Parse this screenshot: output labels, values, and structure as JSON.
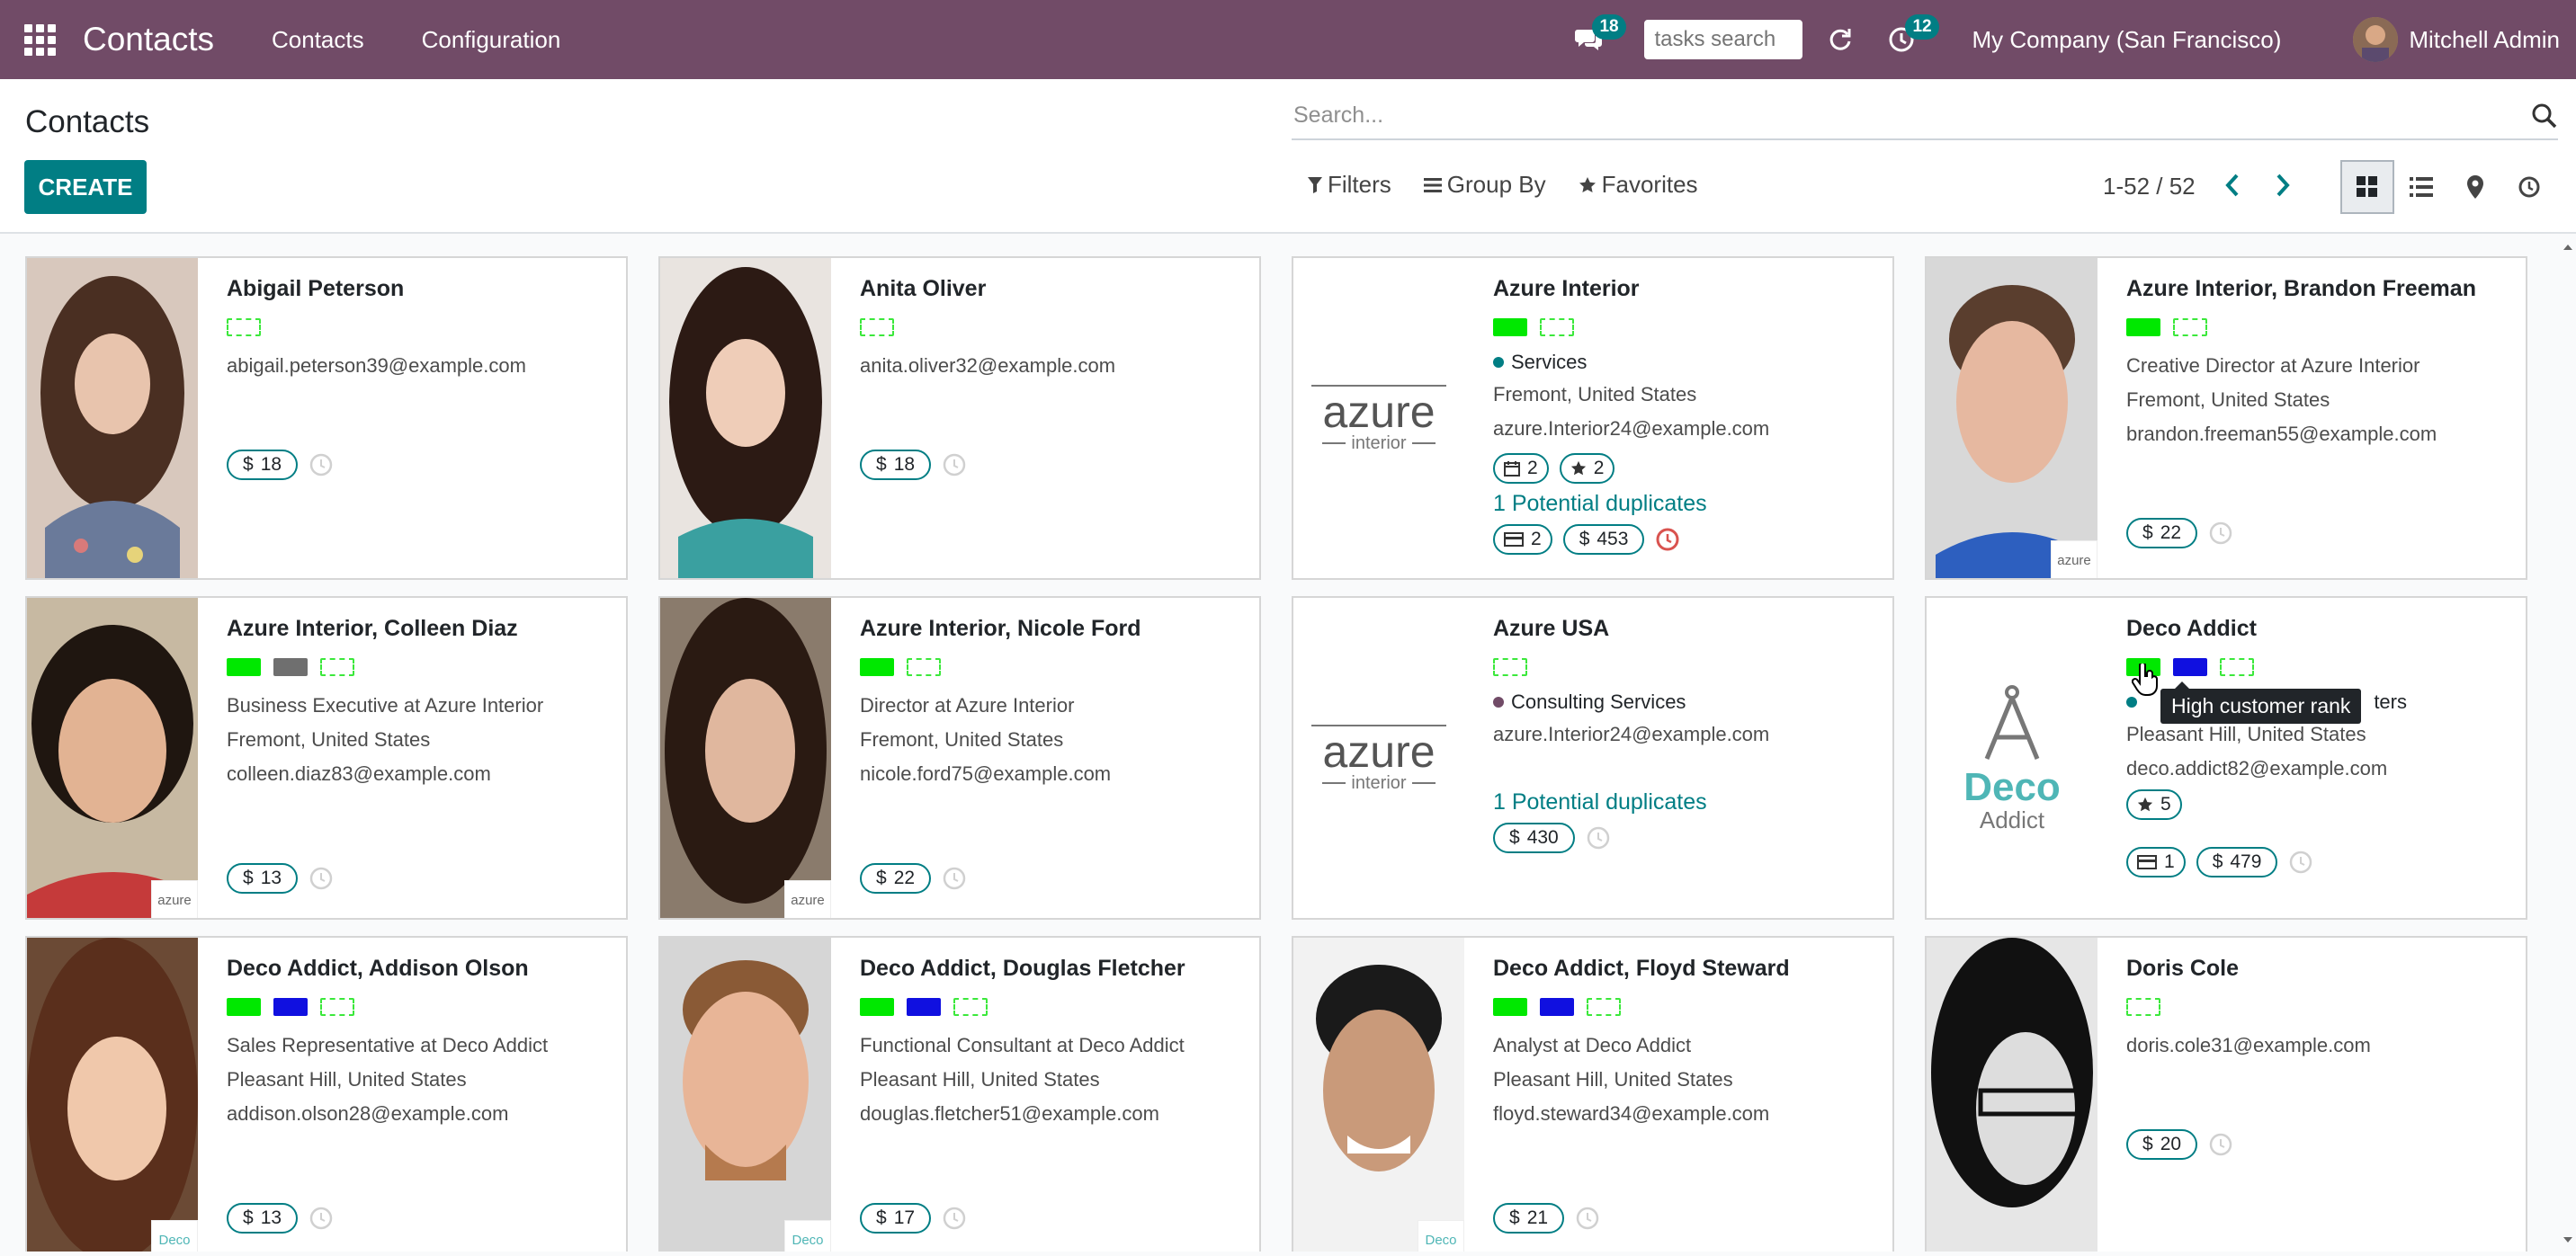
{
  "navbar": {
    "app_name": "Contacts",
    "menus": [
      "Contacts",
      "Configuration"
    ],
    "messages_count": "18",
    "tasks_search_placeholder": "tasks search",
    "activities_count": "12",
    "company": "My Company (San Francisco)",
    "user": "Mitchell Admin"
  },
  "control": {
    "breadcrumb": "Contacts",
    "create_label": "CREATE",
    "search_placeholder": "Search...",
    "filters_label": "Filters",
    "groupby_label": "Group By",
    "favorites_label": "Favorites",
    "pager": "1-52 / 52"
  },
  "tooltip": "High customer rank",
  "cards": [
    {
      "name": "Abigail Peterson",
      "lines": [
        "abigail.peterson39@example.com"
      ],
      "money": "18"
    },
    {
      "name": "Anita Oliver",
      "lines": [
        "anita.oliver32@example.com"
      ],
      "money": "18"
    },
    {
      "name": "Azure Interior",
      "category": "Services",
      "lines": [
        "Fremont, United States",
        "azure.Interior24@example.com"
      ],
      "meetings": "2",
      "stars": "2",
      "duplicates": "1 Potential duplicates",
      "cards_count": "2",
      "money": "453",
      "logo_text": "azure",
      "logo_sub": "interior"
    },
    {
      "name": "Azure Interior, Brandon Freeman",
      "lines": [
        "Creative Director at Azure Interior",
        "Fremont, United States",
        "brandon.freeman55@example.com"
      ],
      "money": "22",
      "mini_logo": "azure"
    },
    {
      "name": "Azure Interior, Colleen Diaz",
      "lines": [
        "Business Executive at Azure Interior",
        "Fremont, United States",
        "colleen.diaz83@example.com"
      ],
      "money": "13",
      "mini_logo": "azure"
    },
    {
      "name": "Azure Interior, Nicole Ford",
      "lines": [
        "Director at Azure Interior",
        "Fremont, United States",
        "nicole.ford75@example.com"
      ],
      "money": "22",
      "mini_logo": "azure"
    },
    {
      "name": "Azure USA",
      "category": "Consulting Services",
      "lines": [
        "azure.Interior24@example.com"
      ],
      "duplicates": "1 Potential duplicates",
      "money": "430",
      "logo_text": "azure",
      "logo_sub": "interior"
    },
    {
      "name": "Deco Addict",
      "category": "ters",
      "lines": [
        "Pleasant Hill, United States",
        "deco.addict82@example.com"
      ],
      "stars": "5",
      "cards_count": "1",
      "money": "479",
      "logo_text": "Deco",
      "logo_sub": "Addict"
    },
    {
      "name": "Deco Addict, Addison Olson",
      "lines": [
        "Sales Representative at Deco Addict",
        "Pleasant Hill, United States",
        "addison.olson28@example.com"
      ],
      "money": "13",
      "mini_logo": "Deco"
    },
    {
      "name": "Deco Addict, Douglas Fletcher",
      "lines": [
        "Functional Consultant at Deco Addict",
        "Pleasant Hill, United States",
        "douglas.fletcher51@example.com"
      ],
      "money": "17",
      "mini_logo": "Deco"
    },
    {
      "name": "Deco Addict, Floyd Steward",
      "lines": [
        "Analyst at Deco Addict",
        "Pleasant Hill, United States",
        "floyd.steward34@example.com"
      ],
      "money": "21",
      "mini_logo": "Deco"
    },
    {
      "name": "Doris Cole",
      "lines": [
        "doris.cole31@example.com"
      ],
      "money": "20"
    }
  ],
  "colors": {
    "brand": "#714b67",
    "accent": "#017e84",
    "tag_green": "#00e800",
    "tag_blue": "#1010e0",
    "tag_gray": "#6f6f6f",
    "overdue": "#d9534f"
  }
}
